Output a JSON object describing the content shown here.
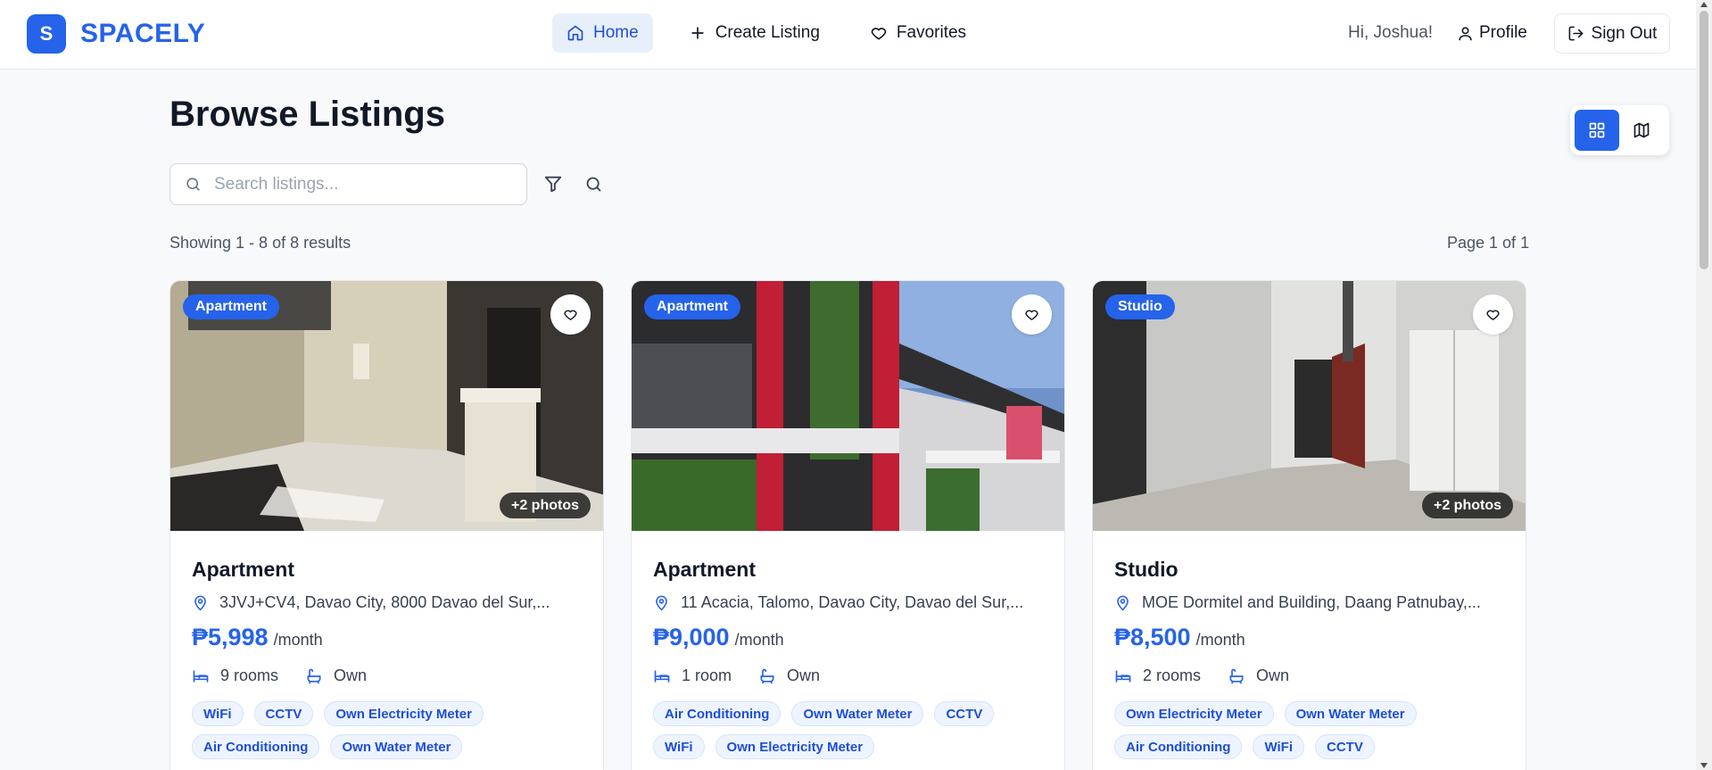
{
  "app": {
    "logo_letter": "S",
    "brand": "SPACELY",
    "brand_color": "#2563eb"
  },
  "nav": {
    "home": "Home",
    "create": "Create Listing",
    "favorites": "Favorites",
    "active": "Home"
  },
  "user": {
    "greeting": "Hi, Joshua!",
    "profile": "Profile",
    "signout": "Sign Out"
  },
  "main": {
    "title": "Browse Listings",
    "search_placeholder": "Search listings...",
    "results": "Showing 1 - 8 of 8 results",
    "page": "Page 1 of 1",
    "view_mode": "grid"
  },
  "listings": [
    {
      "type_badge": "Apartment",
      "photos_more": "+2 photos",
      "title": "Apartment",
      "address": "3JVJ+CV4, Davao City, 8000 Davao del Sur,...",
      "price": "₱5,998",
      "per": "/month",
      "rooms": "9 rooms",
      "bath": "Own",
      "amenities": [
        "WiFi",
        "CCTV",
        "Own Electricity Meter",
        "Air Conditioning",
        "Own Water Meter"
      ],
      "photo_icon": "interior-room-photo"
    },
    {
      "type_badge": "Apartment",
      "photos_more": "",
      "title": "Apartment",
      "address": "11 Acacia, Talomo, Davao City, Davao del Sur,...",
      "price": "₱9,000",
      "per": "/month",
      "rooms": "1 room",
      "bath": "Own",
      "amenities": [
        "Air Conditioning",
        "Own Water Meter",
        "CCTV",
        "WiFi",
        "Own Electricity Meter"
      ],
      "photo_icon": "building-exterior-photo"
    },
    {
      "type_badge": "Studio",
      "photos_more": "+2 photos",
      "title": "Studio",
      "address": "MOE Dormitel and Building, Daang Patnubay,...",
      "price": "₱8,500",
      "per": "/month",
      "rooms": "2 rooms",
      "bath": "Own",
      "amenities": [
        "Own Electricity Meter",
        "Own Water Meter",
        "Air Conditioning",
        "WiFi",
        "CCTV"
      ],
      "photo_icon": "studio-room-photo"
    }
  ]
}
